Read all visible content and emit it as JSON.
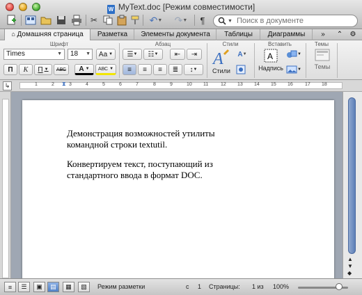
{
  "window": {
    "title": "MyText.doc [Режим совместимости]"
  },
  "toolbar": {
    "search_placeholder": "Поиск в документе",
    "pilcrow": "¶",
    "undo": "↶",
    "redo": "↷"
  },
  "tabs": [
    {
      "label": "Домашняя страница",
      "active": true
    },
    {
      "label": "Разметка"
    },
    {
      "label": "Элементы документа"
    },
    {
      "label": "Таблицы"
    },
    {
      "label": "Диаграммы"
    }
  ],
  "ribbon": {
    "groups": {
      "font": "Шрифт",
      "paragraph": "Абзац",
      "styles": "Стили",
      "insert": "Вставить",
      "themes": "Темы"
    },
    "font_name": "Times",
    "font_size": "18",
    "font_grow": "Aa",
    "bold": "П",
    "italic": "К",
    "underline": "П",
    "strike": "АВС",
    "font_color": "A",
    "highlight": "АВС",
    "styles_label": "Стили",
    "textbox_label": "Надпись",
    "themes_label": "Темы"
  },
  "document": {
    "paragraphs": [
      [
        "Демонстрация возможностей утилиты",
        "командной строки textutil."
      ],
      [
        "Конвертируем текст, поступающий из",
        "стандартного ввода в формат DOC."
      ]
    ]
  },
  "ruler": {
    "h_labels": [
      "1",
      "2",
      "3",
      "4",
      "5",
      "6",
      "7",
      "8",
      "9",
      "10",
      "11",
      "12",
      "13",
      "14",
      "15",
      "16",
      "17",
      "18"
    ]
  },
  "status": {
    "view": "Режим разметки",
    "page_prefix": "с",
    "page_num": "1",
    "pages_label": "Страницы:",
    "pages_value": "1 из",
    "zoom": "100%"
  },
  "colors": {
    "accent": "#4f7fc4"
  }
}
